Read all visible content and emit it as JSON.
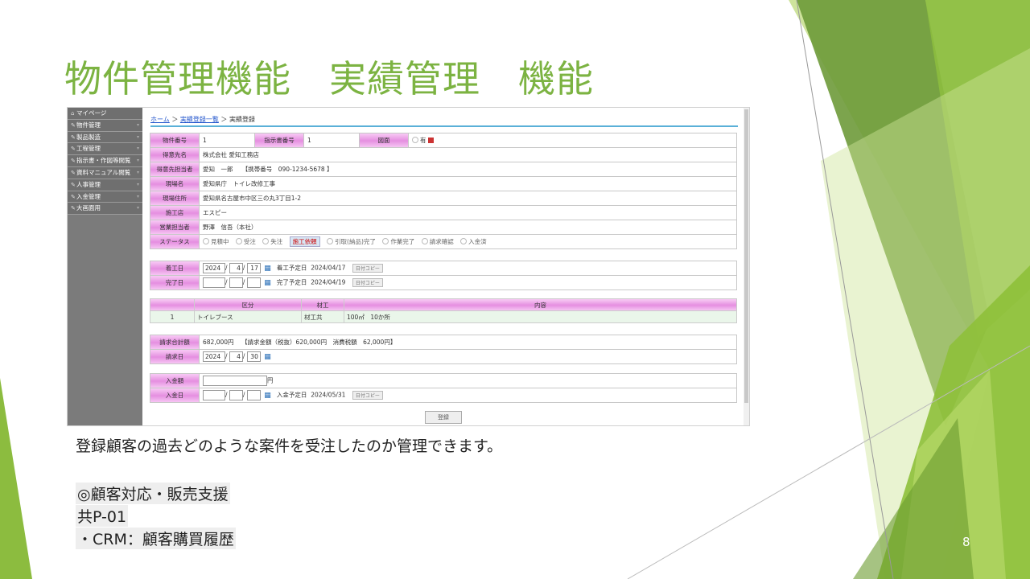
{
  "slide": {
    "title": "物件管理機能　実績管理　機能",
    "description": "登録顧客の過去どのような案件を受注したのか管理できます。",
    "category": "◎顧客対応・販売支援",
    "code": "共P-01",
    "crm": "・CRM：顧客購買履歴",
    "page_number": "8"
  },
  "app": {
    "sidebar": [
      {
        "label": "マイページ"
      },
      {
        "label": "物件管理"
      },
      {
        "label": "製品製造"
      },
      {
        "label": "工程管理"
      },
      {
        "label": "指示書・作図等閲覧"
      },
      {
        "label": "資料マニュアル閲覧"
      },
      {
        "label": "人事管理"
      },
      {
        "label": "入金管理"
      },
      {
        "label": "大画面用"
      }
    ],
    "breadcrumb": {
      "home": "ホーム",
      "sep1": "＞",
      "list": "実績登録一覧",
      "sep2": "＞",
      "current": "実績登録"
    },
    "form": {
      "property_no_label": "物件番号",
      "property_no": "1",
      "order_no_label": "指示書番号",
      "order_no": "1",
      "drawing_label": "図面",
      "drawing_opt": "有",
      "client_label": "得意先名",
      "client": "株式会社 愛知工務店",
      "contact_label": "得意先担当者",
      "contact": "愛知　一郎　　【携帯番号　090-1234-5678 】",
      "site_label": "現場名",
      "site": "愛知県庁　トイレ改修工事",
      "address_label": "現場住所",
      "address": "愛知県名古屋市中区三の丸3丁目1-2",
      "contractor_label": "施工店",
      "contractor": "エスピー",
      "sales_label": "営業担当者",
      "sales": "野澤　信吾（本社）",
      "status_label": "ステータス",
      "statuses": [
        "見積中",
        "受注",
        "失注",
        "施工依頼",
        "引取(納品)完了",
        "作業完了",
        "請求確認",
        "入金済"
      ],
      "selected_status": "施工依頼"
    },
    "schedule": {
      "start_label": "着工日",
      "start_y": "2024",
      "start_m": "4",
      "start_d": "17",
      "start_plan_label": "着工予定日",
      "start_plan": "2024/04/17",
      "end_label": "完了日",
      "end_plan_label": "完了予定日",
      "end_plan": "2024/04/19",
      "copy_label": "日付コピー"
    },
    "work_table": {
      "headers": [
        "",
        "区分",
        "材工",
        "内容"
      ],
      "rows": [
        [
          "1",
          "トイレブース",
          "材工共",
          "100㎡　10か所"
        ]
      ]
    },
    "billing": {
      "total_label": "請求合計額",
      "total": "682,000円",
      "detail": "【請求金額（税抜）620,000円　消費税額　62,000円】",
      "date_label": "請求日",
      "y": "2024",
      "m": "4",
      "d": "30"
    },
    "payment": {
      "amount_label": "入金額",
      "yen": "円",
      "date_label": "入金日",
      "plan_label": "入金予定日",
      "plan": "2024/05/31",
      "copy_label": "日付コピー"
    },
    "register_label": "登録",
    "slash": "/"
  },
  "colors": {
    "title": "#7cb342",
    "label_pink": "#e58fe0",
    "green_dark": "#4f7f2a",
    "green_light": "#a4cf4f"
  }
}
